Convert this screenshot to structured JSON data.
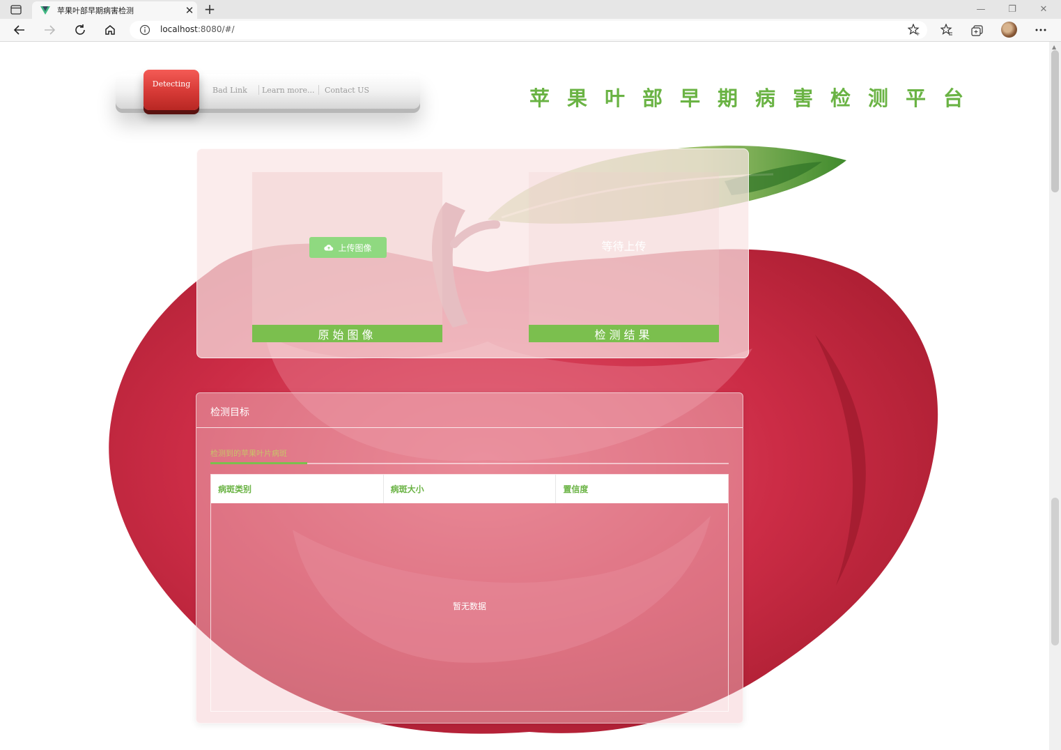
{
  "browser": {
    "tab_title": "苹果叶部早期病害检测",
    "url_host": "localhost",
    "url_rest": ":8080/#/"
  },
  "navbar": {
    "active": "Detecting",
    "links": [
      "Bad Link",
      "Learn more...",
      "Contact US"
    ]
  },
  "header": {
    "title": "苹果叶部早期病害检测平台"
  },
  "upload": {
    "button_label": "上传图像",
    "left_label": "原始图像",
    "right_placeholder": "等待上传",
    "right_label": "检测结果"
  },
  "targets": {
    "title": "检测目标",
    "tab_label": "检测到的苹果叶片病斑",
    "columns": [
      "病斑类别",
      "病斑大小",
      "置信度"
    ],
    "empty_text": "暂无数据"
  },
  "colors": {
    "accent_green": "#7bbf4e",
    "title_green": "#6ab344",
    "active_red": "#d63a36"
  },
  "icons": [
    "sidebar-toggle-icon",
    "vue-favicon-icon",
    "close-icon",
    "plus-icon",
    "back-icon",
    "forward-icon",
    "refresh-icon",
    "home-icon",
    "info-icon",
    "add-favorite-icon",
    "favorites-icon",
    "collections-icon",
    "more-icon",
    "cloud-upload-icon"
  ]
}
